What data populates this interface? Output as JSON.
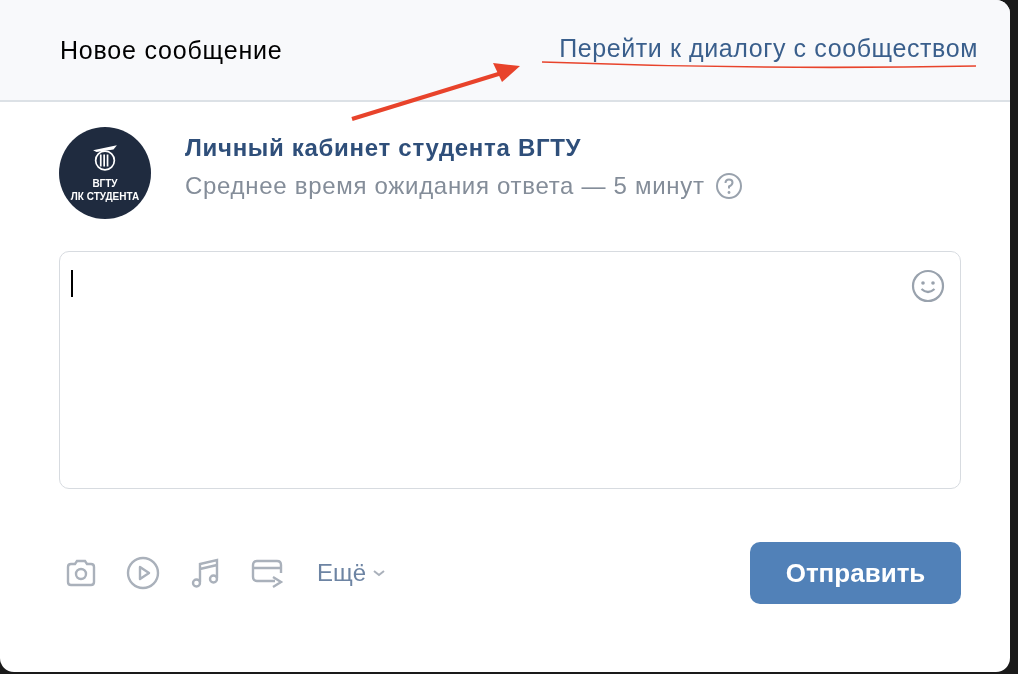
{
  "header": {
    "title": "Новое сообщение",
    "link": "Перейти к диалогу с сообществом"
  },
  "community": {
    "avatar_lines": [
      "ВГТУ",
      "ЛК СТУДЕНТА"
    ],
    "name": "Личный кабинет студента ВГТУ",
    "response_time": "Среднее время ожидания ответа — 5 минут"
  },
  "toolbar": {
    "attachments": [
      {
        "kind": "photo"
      },
      {
        "kind": "video"
      },
      {
        "kind": "music"
      },
      {
        "kind": "card"
      }
    ],
    "more": "Ещё",
    "send": "Отправить"
  }
}
